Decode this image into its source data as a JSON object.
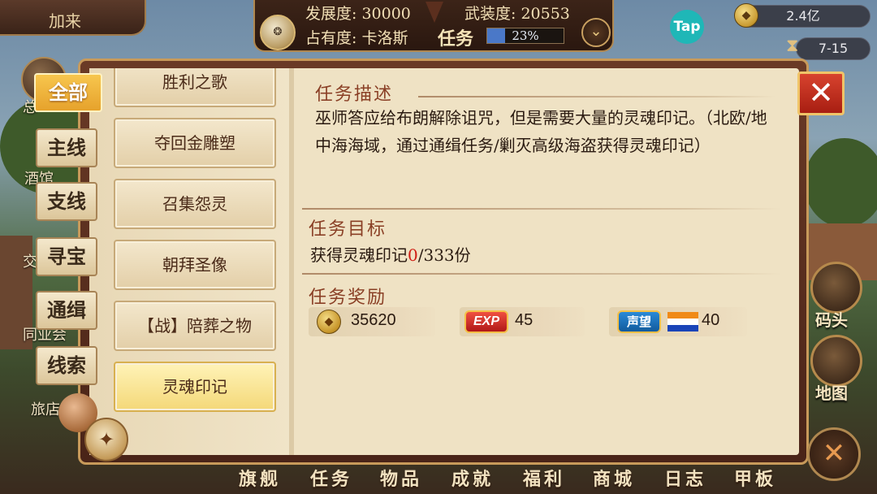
{
  "hud": {
    "city_name": "加来",
    "development": "发展度: 30000",
    "armament": "武装度: 20553",
    "occupancy": "占有度: 卡洛斯",
    "task_label": "任务",
    "task_progress_text": "23%",
    "task_progress": 0.23,
    "tap_label": "Tap",
    "gold_amount": "2.4亿",
    "date": "7-15"
  },
  "city_buttons": [
    "总",
    "酒馆",
    "交",
    "同业会",
    "旅店"
  ],
  "dock": {
    "dock_label": "码头",
    "map_label": "地图"
  },
  "categories": [
    {
      "label": "全部",
      "active": true
    },
    {
      "label": "主线",
      "active": false
    },
    {
      "label": "支线",
      "active": false
    },
    {
      "label": "寻宝",
      "active": false
    },
    {
      "label": "通缉",
      "active": false
    },
    {
      "label": "线索",
      "active": false
    }
  ],
  "quests": [
    {
      "label": "胜利之歌",
      "active": false
    },
    {
      "label": "夺回金雕塑",
      "active": false
    },
    {
      "label": "召集怨灵",
      "active": false
    },
    {
      "label": "朝拜圣像",
      "active": false
    },
    {
      "label": "【战】陪葬之物",
      "active": false
    },
    {
      "label": "灵魂印记",
      "active": true
    }
  ],
  "detail": {
    "desc_title": "任务描述",
    "desc_text": "巫师答应给布朗解除诅咒，但是需要大量的灵魂印记。（北欧/地中海海域，通过通缉任务/剿灭高级海盗获得灵魂印记）",
    "goal_title": "任务目标",
    "goal_prefix": "获得灵魂印记",
    "goal_current": "0",
    "goal_suffix": "/333份",
    "reward_title": "任务奖励",
    "rewards": {
      "coins": "35620",
      "exp_label": "EXP",
      "exp": "45",
      "rep_label": "声望",
      "rep": "40"
    }
  },
  "bottom_nav": [
    "旗舰",
    "任务",
    "物品",
    "成就",
    "福利",
    "商城",
    "日志",
    "甲板"
  ],
  "colors": {
    "accent_red": "#d01e14",
    "title_brown": "#8a3f25",
    "tab_gold": "#f0b440",
    "progress_blue": "#4a78c8"
  },
  "icons": {
    "close": "close-icon",
    "compass": "compass-icon",
    "chevron": "chevron-down-icon",
    "coin": "coin-icon"
  }
}
